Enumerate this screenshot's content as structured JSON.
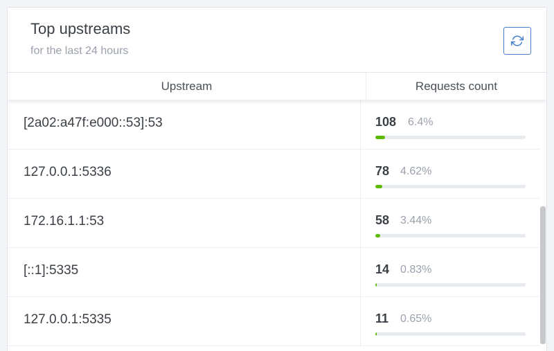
{
  "card": {
    "title": "Top upstreams",
    "subtitle": "for the last 24 hours",
    "refresh_icon": "refresh-icon"
  },
  "table": {
    "columns": [
      "Upstream",
      "Requests count"
    ],
    "rows": [
      {
        "upstream": "[2a02:a47f:e000::53]:53",
        "count": "108",
        "percent": "6.4%",
        "fraction": 0.064
      },
      {
        "upstream": "127.0.0.1:5336",
        "count": "78",
        "percent": "4.62%",
        "fraction": 0.0462
      },
      {
        "upstream": "172.16.1.1:53",
        "count": "58",
        "percent": "3.44%",
        "fraction": 0.0344
      },
      {
        "upstream": "[::1]:5335",
        "count": "14",
        "percent": "0.83%",
        "fraction": 0.0083
      },
      {
        "upstream": "127.0.0.1:5335",
        "count": "11",
        "percent": "0.65%",
        "fraction": 0.0065
      }
    ]
  },
  "colors": {
    "accent": "#467fcf",
    "bar": "#5eba00",
    "track": "#e9ecef"
  }
}
